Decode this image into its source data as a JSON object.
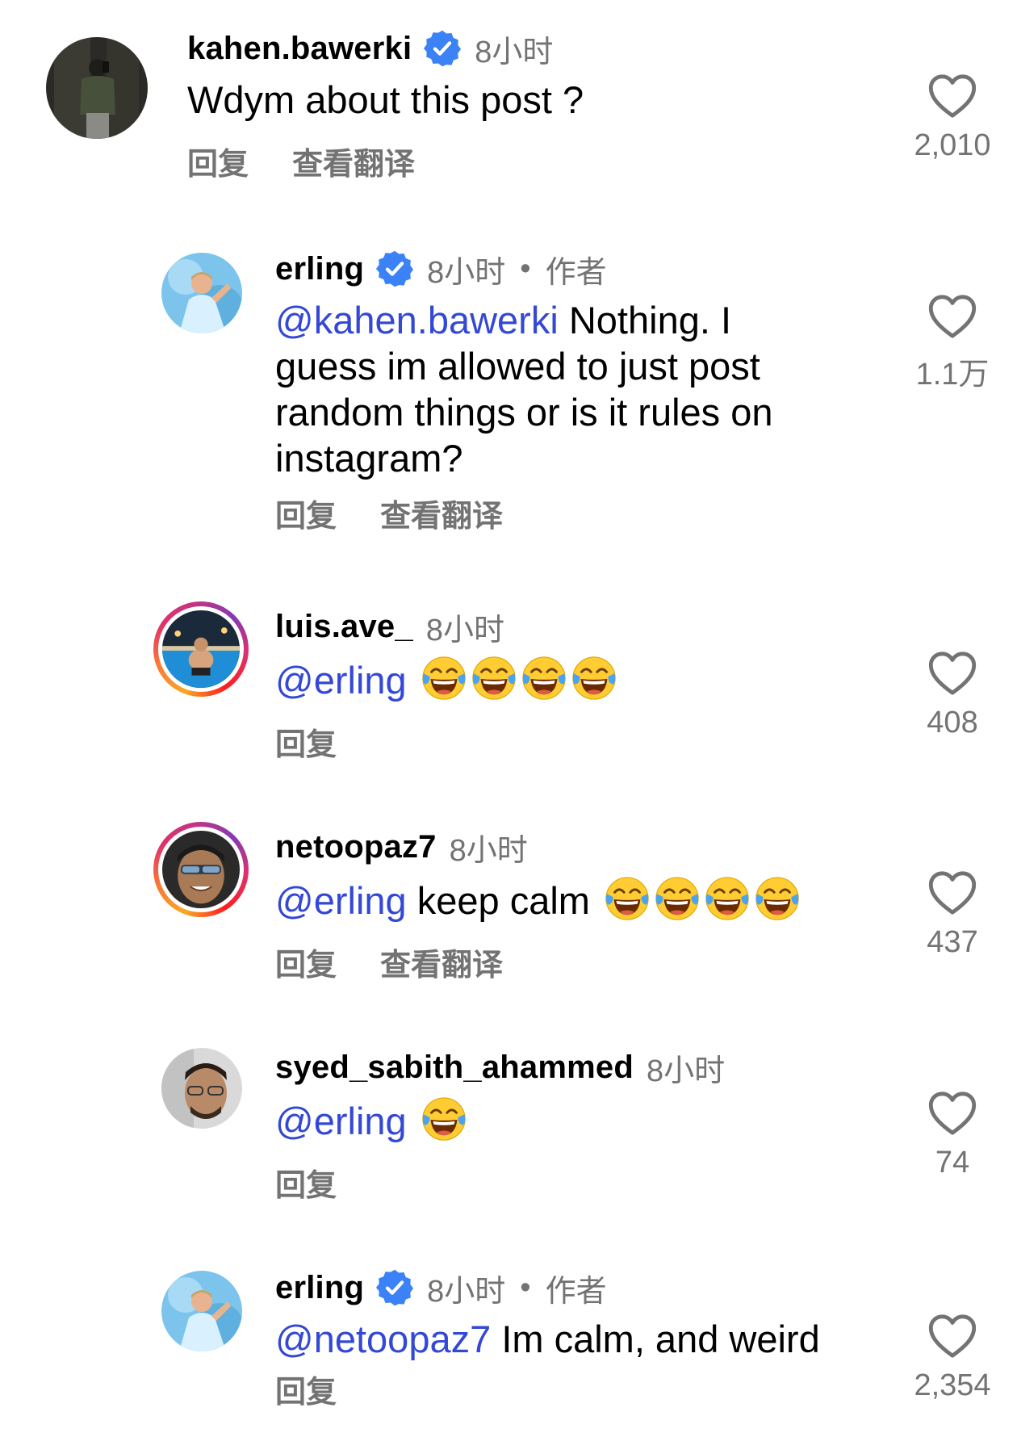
{
  "ui": {
    "reply_label": "回复",
    "translate_label": "查看翻译",
    "author_label": "作者",
    "dot": "•"
  },
  "comments": [
    {
      "username": "kahen.bawerki",
      "time": "8小时",
      "text": "Wdym about this post ?",
      "likes": "2,010"
    },
    {
      "username": "erling",
      "time": "8小时",
      "mention": "@kahen.bawerki",
      "text_line1": "Nothing. I",
      "text_line2": "guess im allowed to just post",
      "text_line3": "random things or is it rules on",
      "text_line4": "instagram?",
      "likes": "1.1万"
    },
    {
      "username": "luis.ave_",
      "time": "8小时",
      "mention": "@erling",
      "likes": "408"
    },
    {
      "username": "netoopaz7",
      "time": "8小时",
      "mention": "@erling",
      "text": "keep calm",
      "likes": "437"
    },
    {
      "username": "syed_sabith_ahammed",
      "time": "8小时",
      "mention": "@erling",
      "likes": "74"
    },
    {
      "username": "erling",
      "time": "8小时",
      "mention": "@netoopaz7",
      "text": "Im calm, and weird",
      "likes": "2,354"
    }
  ],
  "icons": {
    "verified": "verified-badge-icon",
    "heart": "heart-outline-icon",
    "emoji": "face-with-tears-of-joy-icon"
  },
  "colors": {
    "mention": "#3448d6",
    "secondary_text": "#737373",
    "verified_blue": "#3b82f6"
  }
}
